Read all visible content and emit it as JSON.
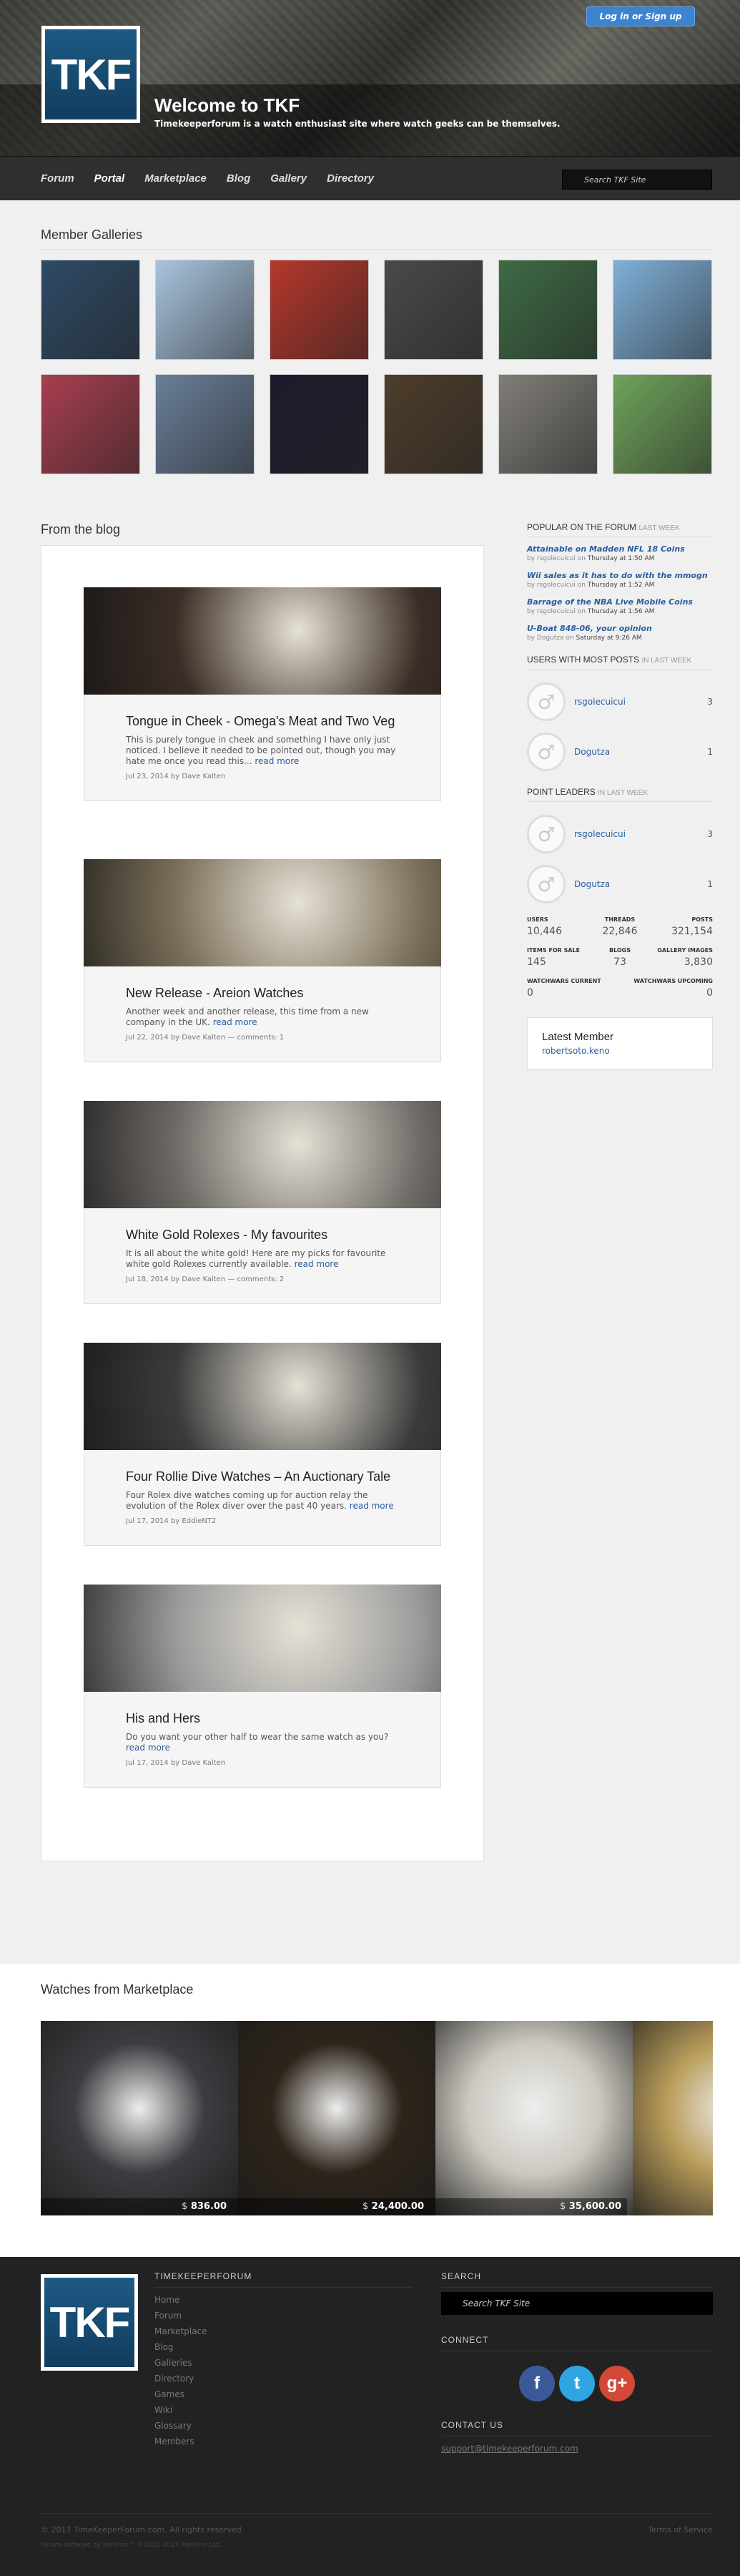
{
  "header": {
    "login_label": "Log in or Sign up",
    "logo_text": "TKF",
    "welcome": "Welcome to TKF",
    "tagline": "Timekeeperforum is a watch enthusiast site where watch geeks can be themselves."
  },
  "nav": {
    "items": [
      "Forum",
      "Portal",
      "Marketplace",
      "Blog",
      "Gallery",
      "Directory"
    ],
    "active": "Portal",
    "search_placeholder": "Search TKF Site"
  },
  "galleries": {
    "title": "Member Galleries",
    "items": [
      {
        "color": "#2e4a66"
      },
      {
        "color": "#a9c4df"
      },
      {
        "color": "#b5372c"
      },
      {
        "color": "#4b4a48"
      },
      {
        "color": "#3e6b44"
      },
      {
        "color": "#7fb0d8"
      },
      {
        "color": "#a83e4f"
      },
      {
        "color": "#6a7f99"
      },
      {
        "color": "#1c1c2e"
      },
      {
        "color": "#4e3d2a"
      },
      {
        "color": "#807d77"
      },
      {
        "color": "#6fa35b"
      }
    ]
  },
  "blog": {
    "title": "From the blog",
    "posts": [
      {
        "title": "Tongue in Cheek - Omega's Meat and Two Veg",
        "excerpt": "This is purely tongue in cheek and something I have only just noticed. I believe it needed to be pointed out, though you may hate me once you read this...",
        "read_more": "read more",
        "meta": "Jul 23, 2014 by Dave Kalten",
        "img_color": "#3a2d26"
      },
      {
        "title": "New Release - Areion Watches",
        "excerpt": "Another week and another release, this time from a new company in the UK.",
        "read_more": "read more",
        "meta": "Jul 22, 2014 by Dave Kalten — comments: 1",
        "img_color": "#7c705a"
      },
      {
        "title": "White Gold Rolexes - My favourites",
        "excerpt": "It is all about the white gold! Here are my picks for favourite white gold Rolexes currently available.",
        "read_more": "read more",
        "meta": "Jul 18, 2014 by Dave Kalten — comments: 2",
        "img_color": "#6e6a66"
      },
      {
        "title": "Four Rollie Dive Watches – An Auctionary Tale",
        "excerpt": "Four Rolex dive watches coming up for auction relay the evolution of the Rolex diver over the past 40 years.",
        "read_more": "read more",
        "meta": "Jul 17, 2014 by EddieNT2",
        "img_color": "#3b3b3b"
      },
      {
        "title": "His and Hers",
        "excerpt": "Do you want your other half to wear the same watch as you?",
        "read_more": "read more",
        "meta": "Jul 17, 2014 by Dave Kalten",
        "img_color": "#9a9a9a"
      }
    ]
  },
  "sidebar": {
    "popular_title": "Popular on the forum",
    "popular_suffix": "last week",
    "popular": [
      {
        "title": "Attainable on Madden NFL 18 Coins",
        "by": "by rsgolecuicui on",
        "when": "Thursday at 1:50 AM"
      },
      {
        "title": "Wii sales as it has to do with the mmogn",
        "by": "by rsgolecuicui on",
        "when": "Thursday at 1:52 AM"
      },
      {
        "title": "Barrage of the NBA Live Mobile Coins",
        "by": "by rsgolecuicui on",
        "when": "Thursday at 1:56 AM"
      },
      {
        "title": "U-Boat 848-06, your opinion",
        "by": "by Dogutza on",
        "when": "Saturday at 9:26 AM"
      }
    ],
    "most_posts_title": "Users with most posts",
    "most_posts_suffix": "in last week",
    "most_posts": [
      {
        "name": "rsgolecuicui",
        "count": "3"
      },
      {
        "name": "Dogutza",
        "count": "1"
      }
    ],
    "leaders_title": "Point leaders",
    "leaders_suffix": "in last week",
    "leaders": [
      {
        "name": "rsgolecuicui",
        "count": "3"
      },
      {
        "name": "Dogutza",
        "count": "1"
      }
    ],
    "stats": [
      {
        "label": "Users",
        "value": "10,446"
      },
      {
        "label": "Threads",
        "value": "22,846"
      },
      {
        "label": "Posts",
        "value": "321,154"
      },
      {
        "label": "Items for sale",
        "value": "145"
      },
      {
        "label": "Blogs",
        "value": "73"
      },
      {
        "label": "Gallery images",
        "value": "3,830"
      }
    ],
    "stats2": [
      {
        "label": "Watchwars current",
        "value": "0"
      },
      {
        "label": "Watchwars upcoming",
        "value": "0"
      }
    ],
    "latest_title": "Latest Member",
    "latest_name": "robertsoto.keno"
  },
  "market": {
    "title": "Watches from Marketplace",
    "items": [
      {
        "currency": "$",
        "price": "836.00",
        "color": "#3b3d40"
      },
      {
        "currency": "$",
        "price": "24,400.00",
        "color": "#2d241a"
      },
      {
        "currency": "$",
        "price": "35,600.00",
        "color": "#ccc9c0"
      },
      {
        "currency": "",
        "price": "",
        "color": "#b89c5a"
      }
    ]
  },
  "footer": {
    "logo_text": "TKF",
    "col1_title": "TIMEKEEPERFORUM",
    "links": [
      "Home",
      "Forum",
      "Marketplace",
      "Blog",
      "Galleries",
      "Directory",
      "Games",
      "Wiki",
      "Glossary",
      "Members"
    ],
    "search_title": "SEARCH",
    "search_placeholder": "Search TKF Site",
    "connect_title": "CONNECT",
    "social": [
      {
        "name": "facebook-icon",
        "glyph": "f",
        "color": "#3b5998"
      },
      {
        "name": "twitter-icon",
        "glyph": "t",
        "color": "#2fa5e2"
      },
      {
        "name": "google-plus-icon",
        "glyph": "g+",
        "color": "#d34836"
      }
    ],
    "contact_title": "CONTACT US",
    "contact_email": "support@timekeeperforum.com",
    "copyright": "© 2017 TimeKeeperForum.com. All rights reserved.",
    "powered": "Forum software by XenForo™ ©2010-2017 XenForo Ltd.",
    "terms": "Terms of Service"
  }
}
